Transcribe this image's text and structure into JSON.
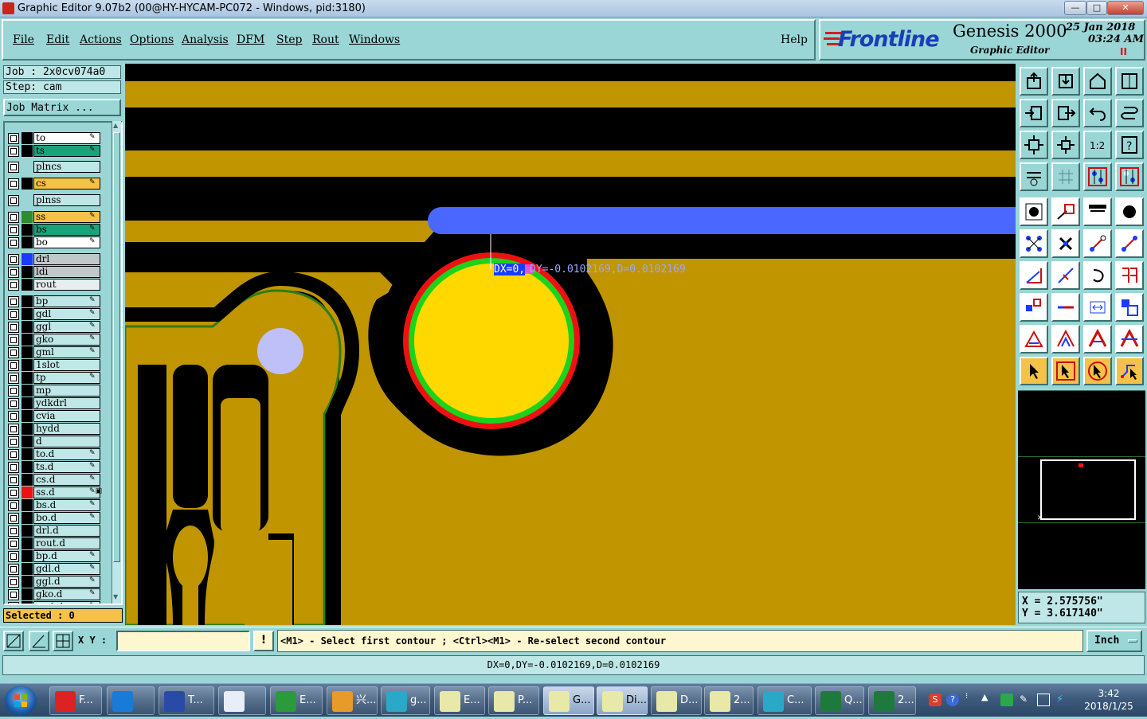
{
  "window": {
    "title": "Graphic Editor 9.07b2 (00@HY-HYCAM-PC072 - Windows, pid:3180)",
    "min": "—",
    "max": "□",
    "close": "✕"
  },
  "menu": {
    "items": [
      "File",
      "Edit",
      "Actions",
      "Options",
      "Analysis",
      "DFM",
      "Step",
      "Rout",
      "Windows"
    ],
    "help": "Help"
  },
  "logo": {
    "brand": "Frontline",
    "product": "Genesis 2000",
    "subtitle": "Graphic Editor",
    "date": "25 Jan 2018",
    "time": "03:24 AM",
    "pause": "II"
  },
  "job": {
    "job": "Job : 2x0cv074a0",
    "step": "Step: cam",
    "matrix_button": "Job Matrix ..."
  },
  "layers": [
    {
      "name": "to",
      "color": "#000000",
      "bg": "#ffffff",
      "flag": "✎"
    },
    {
      "name": "ts",
      "color": "#000000",
      "bg": "#1aa37a",
      "flag": "✎"
    },
    {
      "name": "plncs",
      "color": "#9bd6d6",
      "bg": "#bfe7e7",
      "flag": ""
    },
    {
      "name": "cs",
      "color": "#000000",
      "bg": "#f4c248",
      "flag": "✎"
    },
    {
      "name": "plnss",
      "color": "#9bd6d6",
      "bg": "#bfe7e7",
      "flag": ""
    },
    {
      "name": "ss",
      "color": "#2e8b2e",
      "bg": "#f4c248",
      "flag": "✎"
    },
    {
      "name": "bs",
      "color": "#000000",
      "bg": "#1aa37a",
      "flag": "✎"
    },
    {
      "name": "bo",
      "color": "#000000",
      "bg": "#ffffff",
      "flag": "✎"
    },
    {
      "name": "drl",
      "color": "#1a3cff",
      "bg": "#c0c8c8",
      "flag": ""
    },
    {
      "name": "ldi",
      "color": "#000000",
      "bg": "#c0c8c8",
      "flag": ""
    },
    {
      "name": "rout",
      "color": "#000000",
      "bg": "#e8eeee",
      "flag": ""
    },
    {
      "name": "bp",
      "color": "#000000",
      "bg": "#bfe7e7",
      "flag": "✎"
    },
    {
      "name": "gdl",
      "color": "#000000",
      "bg": "#bfe7e7",
      "flag": "✎"
    },
    {
      "name": "ggl",
      "color": "#000000",
      "bg": "#bfe7e7",
      "flag": "✎"
    },
    {
      "name": "gko",
      "color": "#000000",
      "bg": "#bfe7e7",
      "flag": "✎"
    },
    {
      "name": "gml",
      "color": "#000000",
      "bg": "#bfe7e7",
      "flag": "✎"
    },
    {
      "name": "1slot",
      "color": "#000000",
      "bg": "#bfe7e7",
      "flag": ""
    },
    {
      "name": "tp",
      "color": "#000000",
      "bg": "#bfe7e7",
      "flag": "✎"
    },
    {
      "name": "mp",
      "color": "#000000",
      "bg": "#bfe7e7",
      "flag": ""
    },
    {
      "name": "ydkdrl",
      "color": "#000000",
      "bg": "#bfe7e7",
      "flag": ""
    },
    {
      "name": "cvia",
      "color": "#000000",
      "bg": "#bfe7e7",
      "flag": ""
    },
    {
      "name": "hydd",
      "color": "#000000",
      "bg": "#bfe7e7",
      "flag": ""
    },
    {
      "name": "d",
      "color": "#000000",
      "bg": "#bfe7e7",
      "flag": ""
    },
    {
      "name": "to.d",
      "color": "#000000",
      "bg": "#bfe7e7",
      "flag": "✎"
    },
    {
      "name": "ts.d",
      "color": "#000000",
      "bg": "#bfe7e7",
      "flag": "✎"
    },
    {
      "name": "cs.d",
      "color": "#000000",
      "bg": "#bfe7e7",
      "flag": "✎"
    },
    {
      "name": "ss.d",
      "color": "#ee1111",
      "bg": "#bfe7e7",
      "flag": "✎▣"
    },
    {
      "name": "bs.d",
      "color": "#000000",
      "bg": "#bfe7e7",
      "flag": "✎"
    },
    {
      "name": "bo.d",
      "color": "#000000",
      "bg": "#bfe7e7",
      "flag": "✎"
    },
    {
      "name": "drl.d",
      "color": "#000000",
      "bg": "#bfe7e7",
      "flag": ""
    },
    {
      "name": "rout.d",
      "color": "#000000",
      "bg": "#bfe7e7",
      "flag": ""
    },
    {
      "name": "bp.d",
      "color": "#000000",
      "bg": "#bfe7e7",
      "flag": "✎"
    },
    {
      "name": "gdl.d",
      "color": "#000000",
      "bg": "#bfe7e7",
      "flag": "✎"
    },
    {
      "name": "ggl.d",
      "color": "#000000",
      "bg": "#bfe7e7",
      "flag": "✎"
    },
    {
      "name": "gko.d",
      "color": "#000000",
      "bg": "#bfe7e7",
      "flag": "✎"
    },
    {
      "name": "gml.d",
      "color": "#000000",
      "bg": "#bfe7e7",
      "flag": "✎"
    }
  ],
  "selected": "Selected : 0",
  "measure": {
    "highlight": "DX=0,",
    "label": "DY=-0.0102169,D=0.0102169"
  },
  "coords": {
    "x": "X = 2.575756\"",
    "y": "Y = 3.617140\""
  },
  "cmd": {
    "xy_label": "X Y :",
    "xy_value": "",
    "prompt": "<M1> - Select first contour ; <Ctrl><M1> - Re-select second contour",
    "unit": "Inch"
  },
  "status": "DX=0,DY=-0.0102169,D=0.0102169",
  "taskbar": {
    "tasks": [
      {
        "label": "F...",
        "color": "#d22"
      },
      {
        "label": "",
        "color": "#1a7ad8"
      },
      {
        "label": "T...",
        "color": "#2a4aa8"
      },
      {
        "label": "",
        "color": "#e8eef8"
      },
      {
        "label": "E...",
        "color": "#2a9a3a"
      },
      {
        "label": "兴...",
        "color": "#e89a2a"
      },
      {
        "label": "g...",
        "color": "#2aa8c8"
      },
      {
        "label": "E...",
        "color": "#e8e8a8"
      },
      {
        "label": "P...",
        "color": "#e8e8a8"
      },
      {
        "label": "G...",
        "color": "#e8e8a8"
      },
      {
        "label": "Di...",
        "color": "#e8e8a8"
      },
      {
        "label": "D...",
        "color": "#e8e8a8"
      },
      {
        "label": "2...",
        "color": "#e8e8a8"
      },
      {
        "label": "C...",
        "color": "#2aa8c8"
      },
      {
        "label": "Q...",
        "color": "#1e7a3c"
      },
      {
        "label": "2...",
        "color": "#1e7a3c"
      }
    ],
    "time": "3:42",
    "date": "2018/1/25"
  }
}
